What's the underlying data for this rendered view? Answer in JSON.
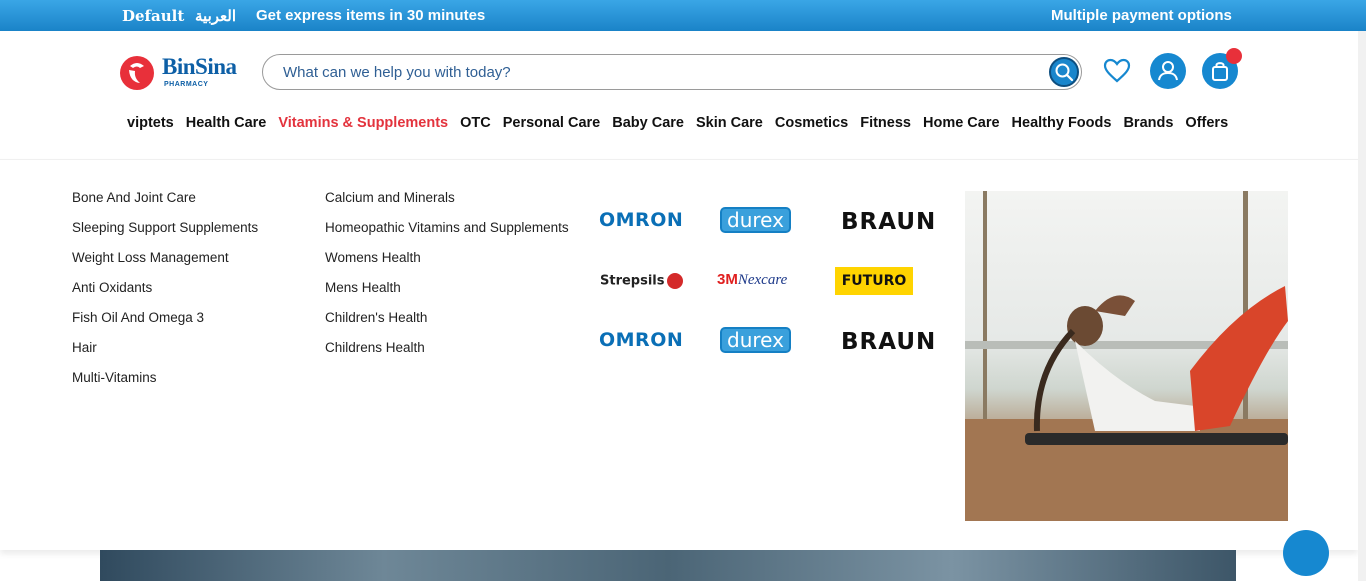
{
  "topbar": {
    "lang_default": "Default",
    "lang_arabic": "العربية",
    "promo": "Get express items in 30 minutes",
    "payment": "Multiple payment options"
  },
  "header": {
    "logo_name": "BinSina",
    "logo_sub": "PHARMACY",
    "search_placeholder": "What can we help you with today?"
  },
  "nav": {
    "items": [
      "viptets",
      "Health Care",
      "Vitamins & Supplements",
      "OTC",
      "Personal Care",
      "Baby Care",
      "Skin Care",
      "Cosmetics",
      "Fitness",
      "Home Care",
      "Healthy Foods",
      "Brands",
      "Offers"
    ],
    "active": "Vitamins & Supplements"
  },
  "menu": {
    "column1": [
      "Bone And Joint Care",
      "Sleeping Support Supplements",
      "Weight Loss Management",
      "Anti Oxidants",
      "Fish Oil And Omega 3",
      "Hair",
      "Multi-Vitamins"
    ],
    "column2": [
      "Calcium and Minerals",
      "Homeopathic Vitamins and Supplements",
      "Womens Health",
      "Mens Health",
      "Children's Health",
      "Childrens Health"
    ],
    "brands": [
      "OMRON",
      "durex",
      "BRAUN",
      "Strepsils",
      "3M",
      "Nexcare",
      "FUTURO",
      "OMRON",
      "durex",
      "BRAUN"
    ]
  },
  "colors": {
    "topbar": "#1f8fd6",
    "accent": "#1688d0",
    "active_nav": "#e3333d",
    "badge": "#e8303a"
  },
  "icons": [
    "search-icon",
    "heart-icon",
    "user-icon",
    "shopping-bag-icon"
  ]
}
